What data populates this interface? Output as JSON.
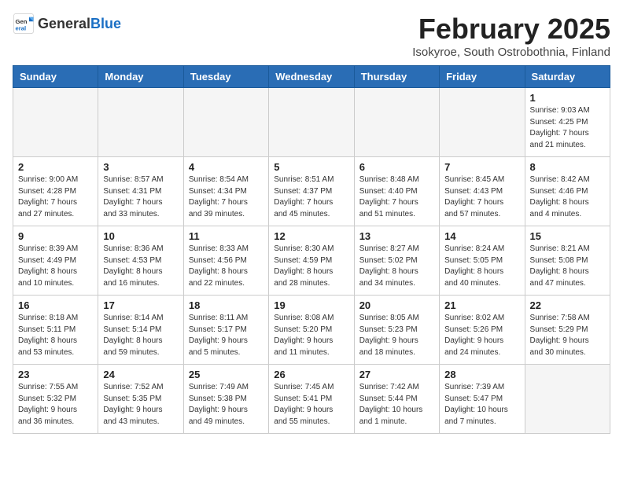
{
  "header": {
    "logo_general": "General",
    "logo_blue": "Blue",
    "month_title": "February 2025",
    "location": "Isokyroe, South Ostrobothnia, Finland"
  },
  "weekdays": [
    "Sunday",
    "Monday",
    "Tuesday",
    "Wednesday",
    "Thursday",
    "Friday",
    "Saturday"
  ],
  "weeks": [
    [
      {
        "day": "",
        "info": ""
      },
      {
        "day": "",
        "info": ""
      },
      {
        "day": "",
        "info": ""
      },
      {
        "day": "",
        "info": ""
      },
      {
        "day": "",
        "info": ""
      },
      {
        "day": "",
        "info": ""
      },
      {
        "day": "1",
        "info": "Sunrise: 9:03 AM\nSunset: 4:25 PM\nDaylight: 7 hours\nand 21 minutes."
      }
    ],
    [
      {
        "day": "2",
        "info": "Sunrise: 9:00 AM\nSunset: 4:28 PM\nDaylight: 7 hours\nand 27 minutes."
      },
      {
        "day": "3",
        "info": "Sunrise: 8:57 AM\nSunset: 4:31 PM\nDaylight: 7 hours\nand 33 minutes."
      },
      {
        "day": "4",
        "info": "Sunrise: 8:54 AM\nSunset: 4:34 PM\nDaylight: 7 hours\nand 39 minutes."
      },
      {
        "day": "5",
        "info": "Sunrise: 8:51 AM\nSunset: 4:37 PM\nDaylight: 7 hours\nand 45 minutes."
      },
      {
        "day": "6",
        "info": "Sunrise: 8:48 AM\nSunset: 4:40 PM\nDaylight: 7 hours\nand 51 minutes."
      },
      {
        "day": "7",
        "info": "Sunrise: 8:45 AM\nSunset: 4:43 PM\nDaylight: 7 hours\nand 57 minutes."
      },
      {
        "day": "8",
        "info": "Sunrise: 8:42 AM\nSunset: 4:46 PM\nDaylight: 8 hours\nand 4 minutes."
      }
    ],
    [
      {
        "day": "9",
        "info": "Sunrise: 8:39 AM\nSunset: 4:49 PM\nDaylight: 8 hours\nand 10 minutes."
      },
      {
        "day": "10",
        "info": "Sunrise: 8:36 AM\nSunset: 4:53 PM\nDaylight: 8 hours\nand 16 minutes."
      },
      {
        "day": "11",
        "info": "Sunrise: 8:33 AM\nSunset: 4:56 PM\nDaylight: 8 hours\nand 22 minutes."
      },
      {
        "day": "12",
        "info": "Sunrise: 8:30 AM\nSunset: 4:59 PM\nDaylight: 8 hours\nand 28 minutes."
      },
      {
        "day": "13",
        "info": "Sunrise: 8:27 AM\nSunset: 5:02 PM\nDaylight: 8 hours\nand 34 minutes."
      },
      {
        "day": "14",
        "info": "Sunrise: 8:24 AM\nSunset: 5:05 PM\nDaylight: 8 hours\nand 40 minutes."
      },
      {
        "day": "15",
        "info": "Sunrise: 8:21 AM\nSunset: 5:08 PM\nDaylight: 8 hours\nand 47 minutes."
      }
    ],
    [
      {
        "day": "16",
        "info": "Sunrise: 8:18 AM\nSunset: 5:11 PM\nDaylight: 8 hours\nand 53 minutes."
      },
      {
        "day": "17",
        "info": "Sunrise: 8:14 AM\nSunset: 5:14 PM\nDaylight: 8 hours\nand 59 minutes."
      },
      {
        "day": "18",
        "info": "Sunrise: 8:11 AM\nSunset: 5:17 PM\nDaylight: 9 hours\nand 5 minutes."
      },
      {
        "day": "19",
        "info": "Sunrise: 8:08 AM\nSunset: 5:20 PM\nDaylight: 9 hours\nand 11 minutes."
      },
      {
        "day": "20",
        "info": "Sunrise: 8:05 AM\nSunset: 5:23 PM\nDaylight: 9 hours\nand 18 minutes."
      },
      {
        "day": "21",
        "info": "Sunrise: 8:02 AM\nSunset: 5:26 PM\nDaylight: 9 hours\nand 24 minutes."
      },
      {
        "day": "22",
        "info": "Sunrise: 7:58 AM\nSunset: 5:29 PM\nDaylight: 9 hours\nand 30 minutes."
      }
    ],
    [
      {
        "day": "23",
        "info": "Sunrise: 7:55 AM\nSunset: 5:32 PM\nDaylight: 9 hours\nand 36 minutes."
      },
      {
        "day": "24",
        "info": "Sunrise: 7:52 AM\nSunset: 5:35 PM\nDaylight: 9 hours\nand 43 minutes."
      },
      {
        "day": "25",
        "info": "Sunrise: 7:49 AM\nSunset: 5:38 PM\nDaylight: 9 hours\nand 49 minutes."
      },
      {
        "day": "26",
        "info": "Sunrise: 7:45 AM\nSunset: 5:41 PM\nDaylight: 9 hours\nand 55 minutes."
      },
      {
        "day": "27",
        "info": "Sunrise: 7:42 AM\nSunset: 5:44 PM\nDaylight: 10 hours\nand 1 minute."
      },
      {
        "day": "28",
        "info": "Sunrise: 7:39 AM\nSunset: 5:47 PM\nDaylight: 10 hours\nand 7 minutes."
      },
      {
        "day": "",
        "info": ""
      }
    ]
  ]
}
